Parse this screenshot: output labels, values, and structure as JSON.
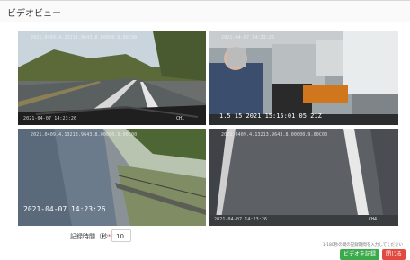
{
  "window": {
    "title": "ビデオビュー"
  },
  "cameras": [
    {
      "osd_top": "2021.0409.4.13213.9643.8.00000.9.00C00",
      "osd_bottom": "2021-04-07 14:23:26",
      "osd_right": "CH1"
    },
    {
      "osd_top": "2021-04-07 14:23:26",
      "osd_mid": "1.5 15 2021 15:15:01 05 21Z"
    },
    {
      "osd_top": "2021.0409.4.13213.9643.8.00000.9.00C00",
      "osd_big": "2021-04-07 14:23:26"
    },
    {
      "osd_top": "2021.0409.4.13213.9643.8.00000.9.00C00",
      "osd_bottom": "2021-04-07 14:23:26",
      "osd_right": "CH4"
    }
  ],
  "form": {
    "label": "記録時間（秒",
    "required_mark": "*",
    "value": "10"
  },
  "hint": "1-180秒の間の記録期間を入力してください",
  "buttons": {
    "record": "ビデオを記録",
    "close": "閉じる"
  },
  "colors": {
    "record": "#3aaa4a",
    "close": "#e24a3f"
  }
}
